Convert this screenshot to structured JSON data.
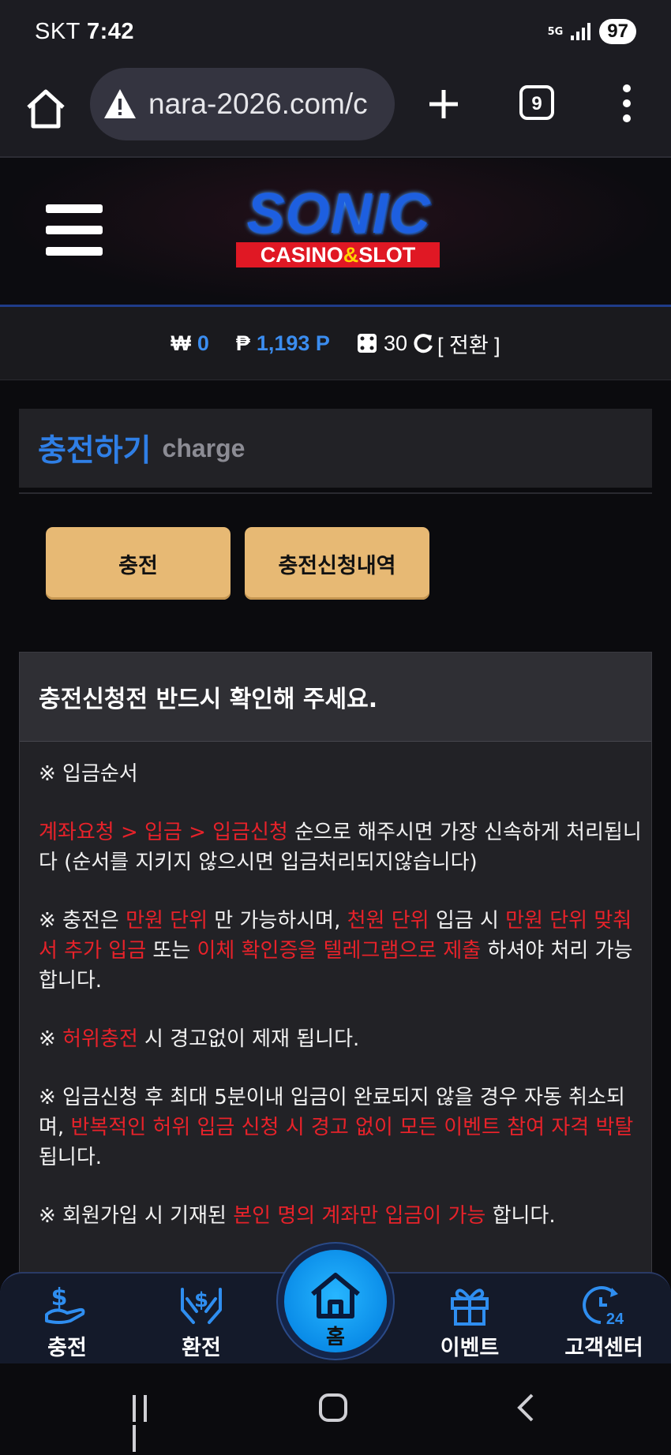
{
  "status_bar": {
    "carrier": "SKT",
    "time": "7:42",
    "network": "5G",
    "battery": "97"
  },
  "browser": {
    "url": "nara-2026.com/c",
    "tab_count": "9"
  },
  "header": {
    "logo_title": "SONIC",
    "logo_subtitle_a": "CASINO",
    "logo_subtitle_amp": "&",
    "logo_subtitle_b": "SLOT"
  },
  "balance": {
    "won_symbol": "₩",
    "won_value": "0",
    "point_symbol": "₱",
    "point_value": "1,193 P",
    "dice_value": "30",
    "convert_label": "[ 전환 ]"
  },
  "section": {
    "title_kr": "충전하기",
    "title_en": "charge"
  },
  "buttons": {
    "charge": "충전",
    "history": "충전신청내역"
  },
  "notice": {
    "heading": "충전신청전 반드시 확인해 주세요.",
    "p1": "※ 입금순서",
    "p2_red": "계좌요청 > 입금 > 입금신청",
    "p2_rest": " 순으로 해주시면 가장 신속하게 처리됩니다 (순서를 지키지 않으시면 입금처리되지않습니다)",
    "p3_a": "※ 충전은 ",
    "p3_red1": "만원 단위",
    "p3_b": " 만 가능하시며, ",
    "p3_red2": "천원 단위",
    "p3_c": " 입금 시 ",
    "p3_red3": "만원 단위 맞춰서 추가 입금",
    "p3_d": " 또는 ",
    "p3_red4": "이체 확인증을 텔레그램으로 제출",
    "p3_e": " 하셔야 처리 가능합니다.",
    "p4_a": "※ ",
    "p4_red": "허위충전",
    "p4_b": " 시 경고없이 제재 됩니다.",
    "p5_a": "※ 입금신청 후 최대 5분이내 입금이 완료되지 않을 경우 자동 취소되며, ",
    "p5_red": "반복적인 허위 입금 신청 시 경고 없이 모든 이벤트 참여 자격 박탈",
    "p5_b": "됩니다.",
    "p6_a": "※ 회원가입 시 기재된 ",
    "p6_red": "본인 명의 계좌만 입금이 가능",
    "p6_b": " 합니다."
  },
  "bottom_nav": {
    "charge": "충전",
    "exchange": "환전",
    "home": "홈",
    "event": "이벤트",
    "support": "고객센터"
  },
  "colors": {
    "accent_blue": "#2f7fe6",
    "gold_button": "#e7b974",
    "warning_red": "#e8222a"
  }
}
